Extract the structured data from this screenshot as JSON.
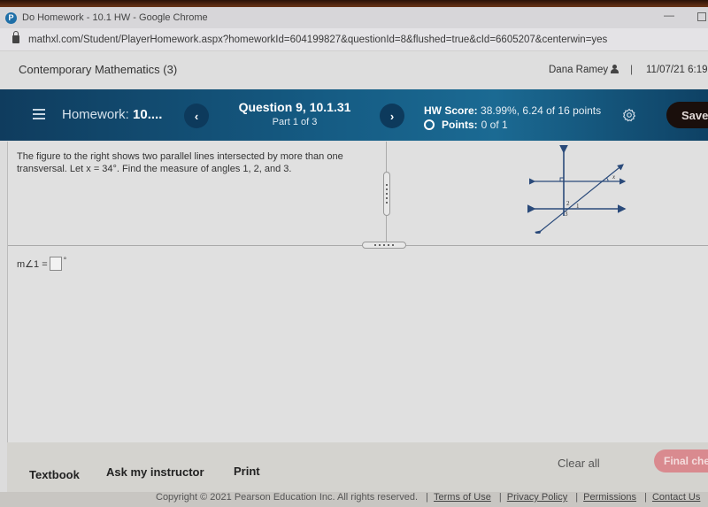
{
  "browser": {
    "window_title": "Do Homework - 10.1 HW - Google Chrome",
    "url": "mathxl.com/Student/PlayerHomework.aspx?homeworkId=604199827&questionId=8&flushed=true&cId=6605207&centerwin=yes",
    "favicon": "P"
  },
  "header": {
    "course_title": "Contemporary Mathematics (3)",
    "user_name": "Dana Ramey",
    "separator": "|",
    "datetime": "11/07/21 6:19"
  },
  "nav": {
    "homework_prefix": "Homework: ",
    "homework_name": "10....",
    "prev_glyph": "‹",
    "next_glyph": "›",
    "question_title": "Question 9, 10.1.31",
    "question_part": "Part 1 of 3",
    "hw_score_label": "HW Score:",
    "hw_score_value": " 38.99%, 6.24 of 16 points",
    "points_label": "Points:",
    "points_value": "0 of 1",
    "save_label": "Save"
  },
  "question": {
    "text": "The figure to the right shows two parallel lines intersected by more than one transversal.  Let  x = 34°. Find the measure of angles 1, 2, and 3.",
    "figure_labels": {
      "x": "x",
      "angle1": "1",
      "angle2": "2",
      "angle3": "3"
    },
    "answer_label": "m∠1 =",
    "answer_value": "",
    "answer_unit": "°"
  },
  "footer": {
    "textbook": "Textbook",
    "ask_instructor": "Ask my instructor",
    "print": "Print",
    "clear_all": "Clear all",
    "final_check": "Final check"
  },
  "copyright": {
    "text": "Copyright © 2021 Pearson Education Inc. All rights reserved.",
    "links": [
      "Terms of Use",
      "Privacy Policy",
      "Permissions",
      "Contact Us"
    ]
  }
}
